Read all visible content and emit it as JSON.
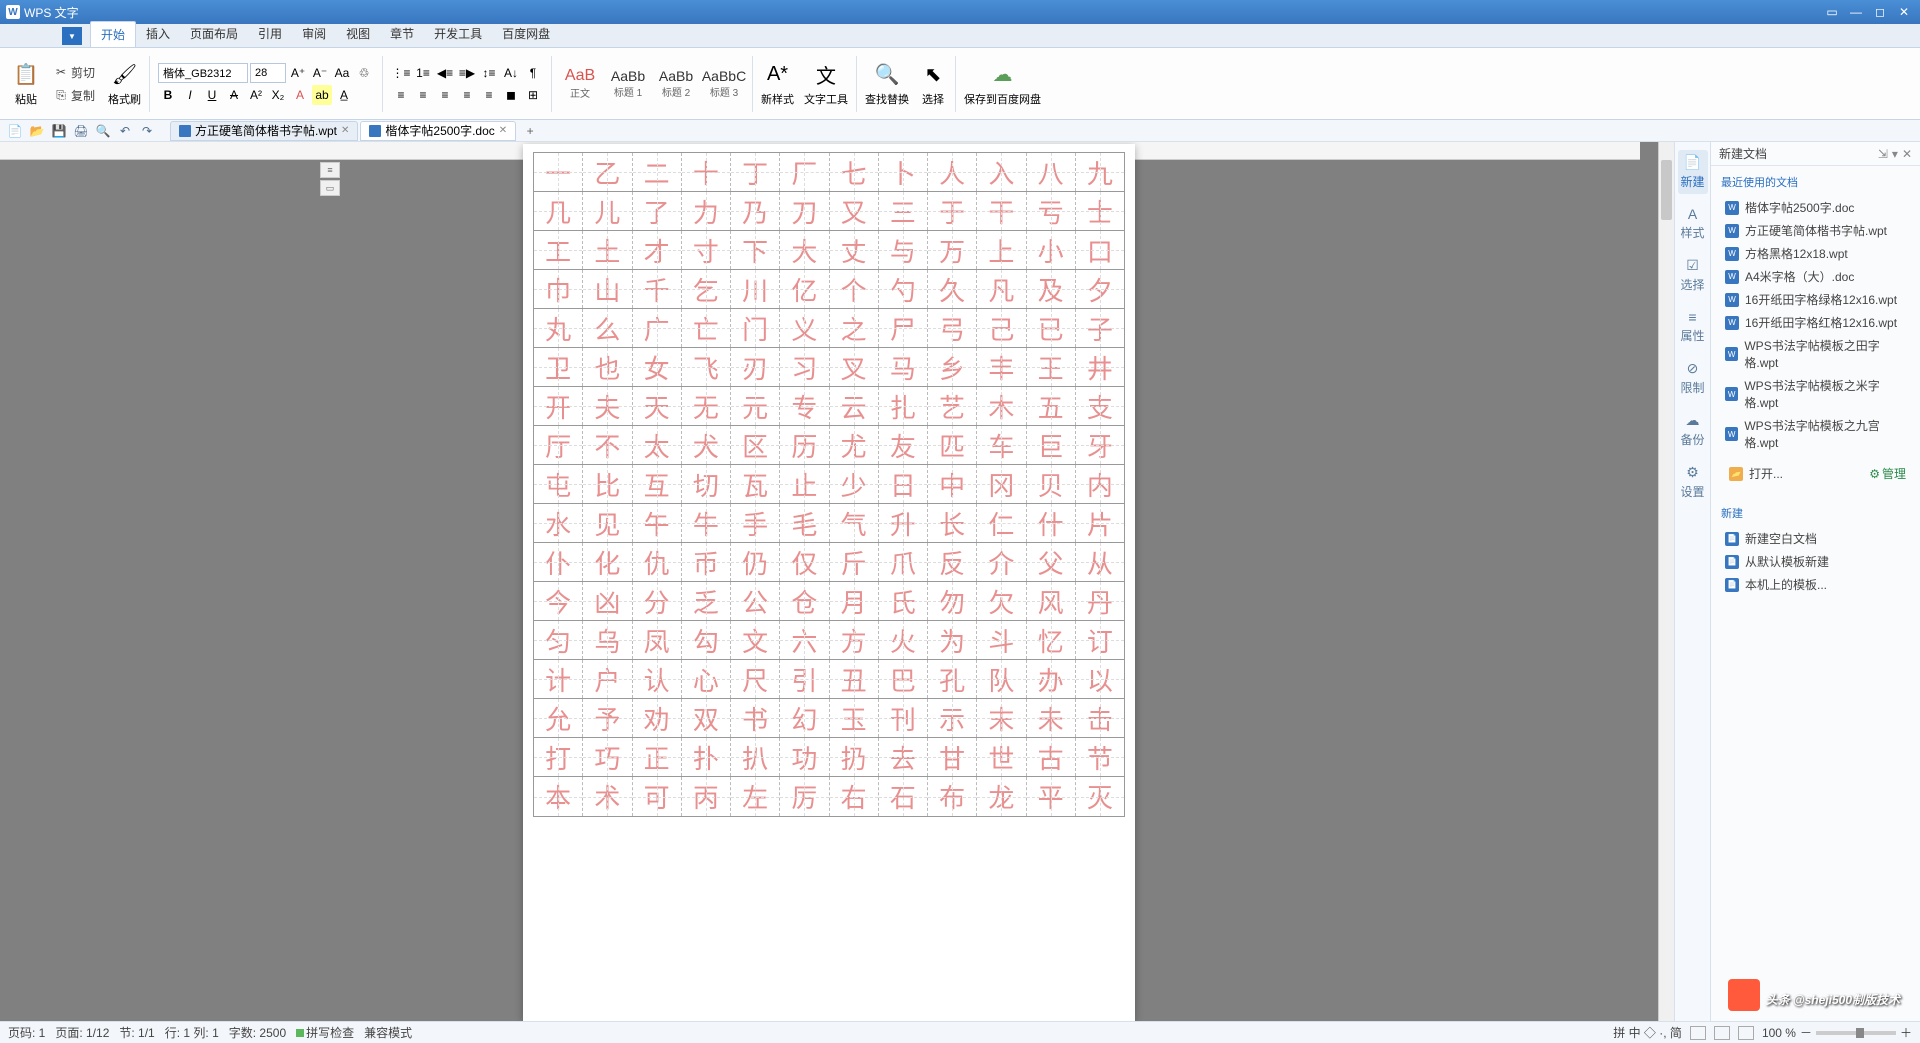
{
  "app": {
    "title": "WPS 文字"
  },
  "menu": {
    "dropdown": "▼",
    "tabs": [
      "开始",
      "插入",
      "页面布局",
      "引用",
      "审阅",
      "视图",
      "章节",
      "开发工具",
      "百度网盘"
    ],
    "active": 0
  },
  "ribbon": {
    "paste": "粘贴",
    "cut": "剪切",
    "copy": "复制",
    "formatpainter": "格式刷",
    "fontname": "楷体_GB2312",
    "fontsize": "28",
    "styles": [
      {
        "prev": "AaB",
        "lbl": "正文",
        "red": true
      },
      {
        "prev": "AaBb",
        "lbl": "标题 1"
      },
      {
        "prev": "AaBb",
        "lbl": "标题 2"
      },
      {
        "prev": "AaBbC",
        "lbl": "标题 3"
      }
    ],
    "newstyle": "新样式",
    "texttool": "文字工具",
    "findreplace": "查找替换",
    "select": "选择",
    "savecloud": "保存到百度网盘"
  },
  "doctabs": [
    {
      "name": "方正硬笔简体楷书字帖.wpt",
      "active": false
    },
    {
      "name": "楷体字帖2500字.doc",
      "active": true
    }
  ],
  "chars": [
    [
      "一",
      "乙",
      "二",
      "十",
      "丁",
      "厂",
      "七",
      "卜",
      "人",
      "入",
      "八",
      "九"
    ],
    [
      "几",
      "儿",
      "了",
      "力",
      "乃",
      "刀",
      "又",
      "三",
      "于",
      "干",
      "亏",
      "士"
    ],
    [
      "工",
      "土",
      "才",
      "寸",
      "下",
      "大",
      "丈",
      "与",
      "万",
      "上",
      "小",
      "口"
    ],
    [
      "巾",
      "山",
      "千",
      "乞",
      "川",
      "亿",
      "个",
      "勺",
      "久",
      "凡",
      "及",
      "夕"
    ],
    [
      "丸",
      "么",
      "广",
      "亡",
      "门",
      "义",
      "之",
      "尸",
      "弓",
      "己",
      "已",
      "子"
    ],
    [
      "卫",
      "也",
      "女",
      "飞",
      "刃",
      "习",
      "叉",
      "马",
      "乡",
      "丰",
      "王",
      "井"
    ],
    [
      "开",
      "夫",
      "天",
      "无",
      "元",
      "专",
      "云",
      "扎",
      "艺",
      "木",
      "五",
      "支"
    ],
    [
      "厅",
      "不",
      "太",
      "犬",
      "区",
      "历",
      "尤",
      "友",
      "匹",
      "车",
      "巨",
      "牙"
    ],
    [
      "屯",
      "比",
      "互",
      "切",
      "瓦",
      "止",
      "少",
      "日",
      "中",
      "冈",
      "贝",
      "内"
    ],
    [
      "水",
      "见",
      "午",
      "牛",
      "手",
      "毛",
      "气",
      "升",
      "长",
      "仁",
      "什",
      "片"
    ],
    [
      "仆",
      "化",
      "仇",
      "币",
      "仍",
      "仅",
      "斤",
      "爪",
      "反",
      "介",
      "父",
      "从"
    ],
    [
      "今",
      "凶",
      "分",
      "乏",
      "公",
      "仓",
      "月",
      "氏",
      "勿",
      "欠",
      "风",
      "丹"
    ],
    [
      "匀",
      "乌",
      "凤",
      "勾",
      "文",
      "六",
      "方",
      "火",
      "为",
      "斗",
      "忆",
      "订"
    ],
    [
      "计",
      "户",
      "认",
      "心",
      "尺",
      "引",
      "丑",
      "巴",
      "孔",
      "队",
      "办",
      "以"
    ],
    [
      "允",
      "予",
      "劝",
      "双",
      "书",
      "幻",
      "玉",
      "刊",
      "示",
      "末",
      "未",
      "击"
    ],
    [
      "打",
      "巧",
      "正",
      "扑",
      "扒",
      "功",
      "扔",
      "去",
      "甘",
      "世",
      "古",
      "节"
    ],
    [
      "本",
      "术",
      "可",
      "丙",
      "左",
      "厉",
      "右",
      "石",
      "布",
      "龙",
      "平",
      "灭"
    ]
  ],
  "sidetabs": [
    {
      "ico": "📄",
      "lbl": "新建"
    },
    {
      "ico": "A",
      "lbl": "样式"
    },
    {
      "ico": "☑",
      "lbl": "选择"
    },
    {
      "ico": "≡",
      "lbl": "属性"
    },
    {
      "ico": "⊘",
      "lbl": "限制"
    },
    {
      "ico": "☁",
      "lbl": "备份"
    },
    {
      "ico": "⚙",
      "lbl": "设置"
    }
  ],
  "sidepanel": {
    "title": "新建文档",
    "recent_title": "最近使用的文档",
    "recent": [
      "楷体字帖2500字.doc",
      "方正硬笔简体楷书字帖.wpt",
      "方格黑格12x18.wpt",
      "A4米字格（大）.doc",
      "16开纸田字格绿格12x16.wpt",
      "16开纸田字格红格12x16.wpt",
      "WPS书法字帖模板之田字格.wpt",
      "WPS书法字帖模板之米字格.wpt",
      "WPS书法字帖模板之九宫格.wpt"
    ],
    "open": "打开...",
    "manage": "管理",
    "new_title": "新建",
    "new_items": [
      "新建空白文档",
      "从默认模板新建",
      "本机上的模板..."
    ]
  },
  "status": {
    "page": "页码: 1",
    "pages": "页面: 1/12",
    "section": "节: 1/1",
    "line": "行: 1 列: 1",
    "chars": "字数: 2500",
    "spell": "拼写检查",
    "compat": "兼容模式",
    "ime": "拼 中 ◇ ·, 简",
    "zoom": "100 %"
  },
  "watermark": "头条 @sheji500制版技术"
}
